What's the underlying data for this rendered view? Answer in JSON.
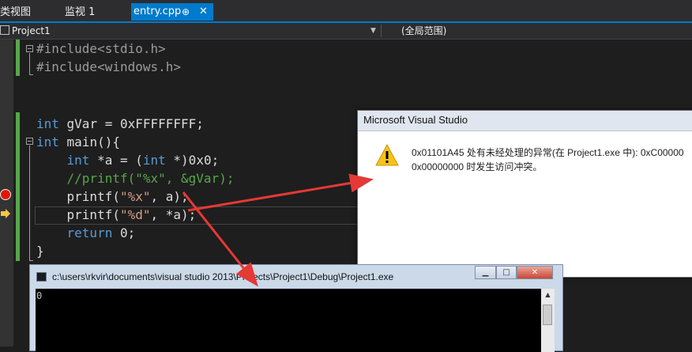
{
  "tabs": {
    "left_partial": "类视图",
    "watch": "监视 1",
    "active_file": "entry.cpp",
    "pin_glyph": "⊕",
    "close_glyph": "✕"
  },
  "navbar": {
    "project": "Project1",
    "scope": "(全局范围)"
  },
  "code_lines": [
    "#include<stdio.h>",
    "#include<windows.h>",
    "",
    "",
    "int gVar = 0xFFFFFFFF;",
    "int main(){",
    "    int *a = (int *)0x0;",
    "    //printf(\"%x\", &gVar);",
    "    printf(\"%x\", a);",
    "    printf(\"%d\", *a);",
    "    return 0;",
    "}"
  ],
  "messagebox": {
    "title": "Microsoft Visual Studio",
    "line1": "0x01101A45 处有未经处理的异常(在 Project1.exe 中):  0xC00000",
    "line2": "0x00000000 时发生访问冲突。"
  },
  "console": {
    "title": "c:\\users\\rkvir\\documents\\visual studio 2013\\Projects\\Project1\\Debug\\Project1.exe",
    "output": "0",
    "min_glyph": "▁",
    "max_glyph": "□",
    "close_glyph": "✕"
  },
  "colors": {
    "accent": "#007acc",
    "arrow": "#e53935",
    "breakpoint": "#e51400",
    "instruction_pointer": "#f6c544"
  },
  "icons": [
    "warning-icon",
    "breakpoint-icon",
    "current-line-arrow-icon",
    "console-app-icon"
  ]
}
